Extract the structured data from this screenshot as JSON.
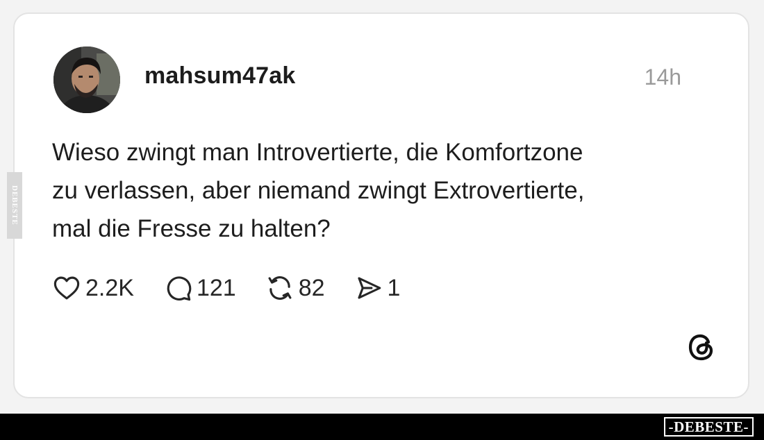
{
  "post": {
    "username": "mahsum47ak",
    "time": "14h",
    "text_lines": [
      "Wieso zwingt man Introvertierte, die Komfortzone",
      "zu verlassen, aber niemand zwingt Extrovertierte,",
      "mal die Fresse zu halten?"
    ],
    "actions": {
      "likes": "2.2K",
      "comments": "121",
      "reposts": "82",
      "shares": "1"
    }
  },
  "icons": {
    "like": "heart-icon",
    "comment": "speech-bubble-icon",
    "repost": "repost-icon",
    "share": "send-icon",
    "brand": "threads-logo-icon"
  },
  "watermark": {
    "side": "DEBESTE",
    "bottom": "-DEBESTE-"
  },
  "colors": {
    "page_background": "#f3f3f3",
    "card_background": "#ffffff",
    "text": "#1d1d1d",
    "muted": "#9a9a9a",
    "bottom_bar": "#000000"
  }
}
